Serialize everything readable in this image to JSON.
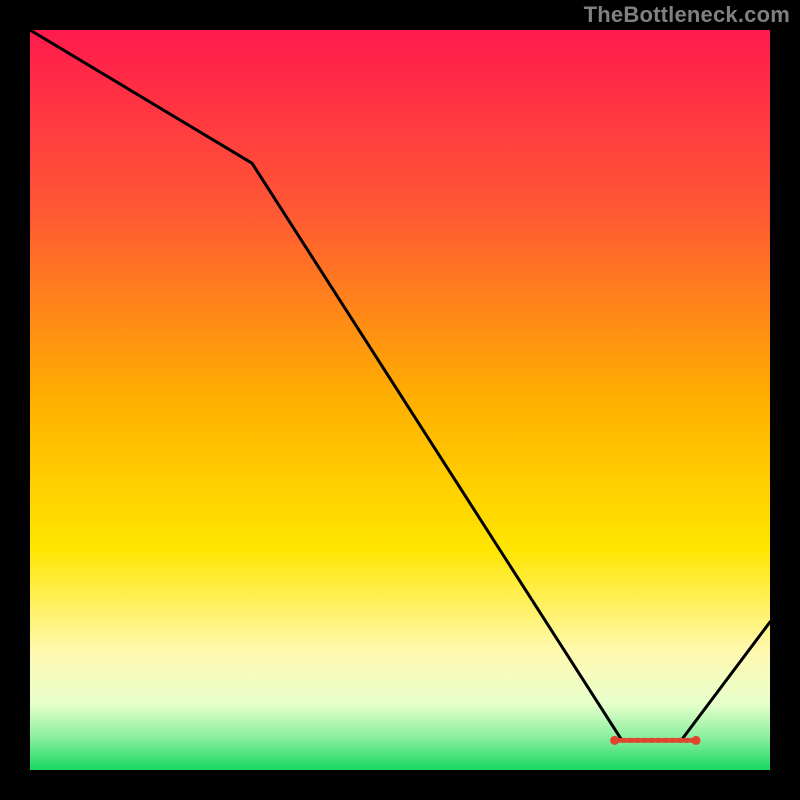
{
  "watermark": "TheBottleneck.com",
  "chart_data": {
    "type": "line",
    "title": "",
    "xlabel": "",
    "ylabel": "",
    "xlim": [
      0,
      100
    ],
    "ylim": [
      0,
      100
    ],
    "x": [
      0,
      30,
      80,
      88,
      100
    ],
    "y": [
      100,
      82,
      4,
      4,
      20
    ],
    "optimal_band": {
      "x_start": 79,
      "x_end": 90,
      "y": 4
    },
    "gradient_stops": [
      {
        "offset": 0.0,
        "color": "#ff1a4d"
      },
      {
        "offset": 0.25,
        "color": "#ff5a33"
      },
      {
        "offset": 0.5,
        "color": "#ffb000"
      },
      {
        "offset": 0.7,
        "color": "#ffe600"
      },
      {
        "offset": 0.84,
        "color": "#fff9b0"
      },
      {
        "offset": 0.91,
        "color": "#e8ffcc"
      },
      {
        "offset": 0.955,
        "color": "#8cf0a0"
      },
      {
        "offset": 1.0,
        "color": "#18d860"
      }
    ]
  }
}
